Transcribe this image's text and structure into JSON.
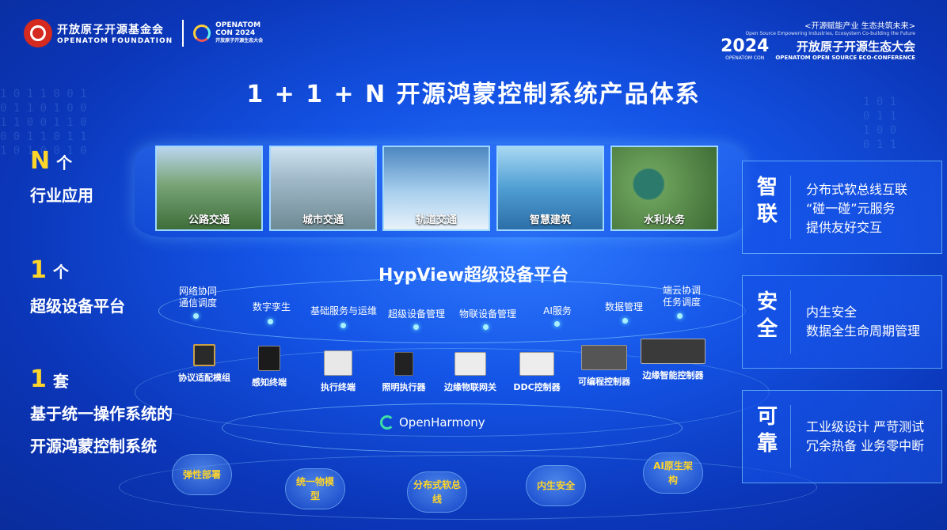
{
  "header": {
    "org_cn": "开放原子开源基金会",
    "org_en": "OPENATOM FOUNDATION",
    "con_line1": "OPENATOM",
    "con_line2": "CON 2024",
    "con_line3": "开放原子开源生态大会",
    "slogan": "<开源赋能产业 生态共筑未来>",
    "slogan_en": "Open Source Empowering Industries, Ecosystem Co-building the Future",
    "year": "2024",
    "year_sub": "OPENATOM CON",
    "conf_cn": "开放原子开源生态大会",
    "conf_en": "OPENATOM OPEN SOURCE ECO-CONFERENCE"
  },
  "title": "1 + 1 + N 开源鸿蒙控制系统产品体系",
  "left": {
    "n": {
      "big": "N",
      "unit": "个",
      "desc": "行业应用"
    },
    "one_platform": {
      "big": "1",
      "unit": "个",
      "desc": "超级设备平台"
    },
    "one_system": {
      "big": "1",
      "unit": "套",
      "desc1": "基于统一操作系统的",
      "desc2": "开源鸿蒙控制系统"
    }
  },
  "industries": [
    "公路交通",
    "城市交通",
    "轨道交通",
    "智慧建筑",
    "水利水务"
  ],
  "platform_title": "HypView超级设备平台",
  "services": [
    {
      "l1": "网络协同",
      "l2": "通信调度"
    },
    {
      "l1": "数字孪生",
      "l2": ""
    },
    {
      "l1": "基础服务与运维",
      "l2": ""
    },
    {
      "l1": "超级设备管理",
      "l2": ""
    },
    {
      "l1": "物联设备管理",
      "l2": ""
    },
    {
      "l1": "AI服务",
      "l2": ""
    },
    {
      "l1": "数据管理",
      "l2": ""
    },
    {
      "l1": "端云协调",
      "l2": "任务调度"
    }
  ],
  "devices": [
    "协议适配模组",
    "感知终端",
    "执行终端",
    "照明执行器",
    "边缘物联网关",
    "DDC控制器",
    "可编程控制器",
    "边缘智能控制器"
  ],
  "openharmony": "OpenHarmony",
  "clouds": [
    {
      "l1": "弹性部署",
      "l2": ""
    },
    {
      "l1": "统一物模",
      "l2": "型"
    },
    {
      "l1": "分布式软总",
      "l2": "线"
    },
    {
      "l1": "内生安全",
      "l2": ""
    },
    {
      "l1": "AI原生架",
      "l2": "构"
    }
  ],
  "cards": [
    {
      "h1": "智",
      "h2": "联",
      "lines": [
        "分布式软总线互联",
        "“碰一碰”元服务",
        "提供友好交互"
      ]
    },
    {
      "h1": "安",
      "h2": "全",
      "lines": [
        "内生安全",
        "数据全生命周期管理"
      ]
    },
    {
      "h1": "可",
      "h2": "靠",
      "lines": [
        "工业级设计 严苛测试",
        "冗余热备 业务零中断"
      ]
    }
  ],
  "colors": {
    "accent": "#ffd52a",
    "bg": "#1454e6",
    "line": "#8cd2ff"
  }
}
